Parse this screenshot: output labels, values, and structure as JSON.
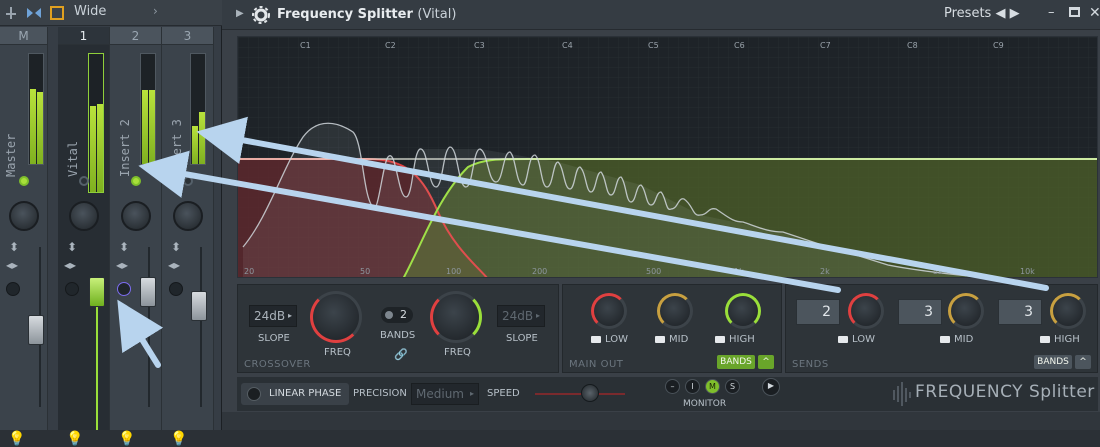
{
  "mixer": {
    "toolbar_label": "Wide",
    "strips": [
      {
        "header": "M",
        "name": "Master"
      },
      {
        "header": "1",
        "name": "Vital"
      },
      {
        "header": "2",
        "name": "Insert 2"
      },
      {
        "header": "3",
        "name": "Insert 3"
      }
    ]
  },
  "plugin": {
    "title": "Frequency Splitter",
    "title_suffix": "(Vital)",
    "presets_label": "Presets",
    "note_labels": [
      "C1",
      "C2",
      "C3",
      "C4",
      "C5",
      "C6",
      "C7",
      "C8",
      "C9"
    ],
    "freq_labels": [
      "20",
      "50",
      "100",
      "200",
      "500",
      "1k",
      "2k",
      "5k",
      "10k"
    ],
    "crossover": {
      "slope_left": "24dB",
      "slope_right": "24dB",
      "slope_label": "SLOPE",
      "bands_value": "2",
      "bands_label": "BANDS",
      "freq_label": "FREQ",
      "section_title": "CROSSOVER"
    },
    "main_out": {
      "labels": [
        "LOW",
        "MID",
        "HIGH"
      ],
      "bands_button": "BANDS",
      "section_title": "MAIN OUT"
    },
    "sends": {
      "values": [
        "2",
        "3",
        "3"
      ],
      "labels": [
        "LOW",
        "MID",
        "HIGH"
      ],
      "bands_button": "BANDS",
      "section_title": "SENDS"
    },
    "bottom": {
      "linear_phase": "LINEAR PHASE",
      "precision_label": "PRECISION",
      "precision_value": "Medium",
      "speed_label": "SPEED",
      "monitor_label": "MONITOR",
      "monitor_buttons": [
        "–",
        "I",
        "M",
        "S"
      ],
      "logo_text": "FREQUENCY",
      "logo_text2": "Splitter"
    }
  },
  "colors": {
    "low_band": "#e04040",
    "high_band": "#9adf3a",
    "mid_knob": "#c8a040",
    "accent_green": "#7fbf2b",
    "arrow": "#b8d4ee"
  }
}
